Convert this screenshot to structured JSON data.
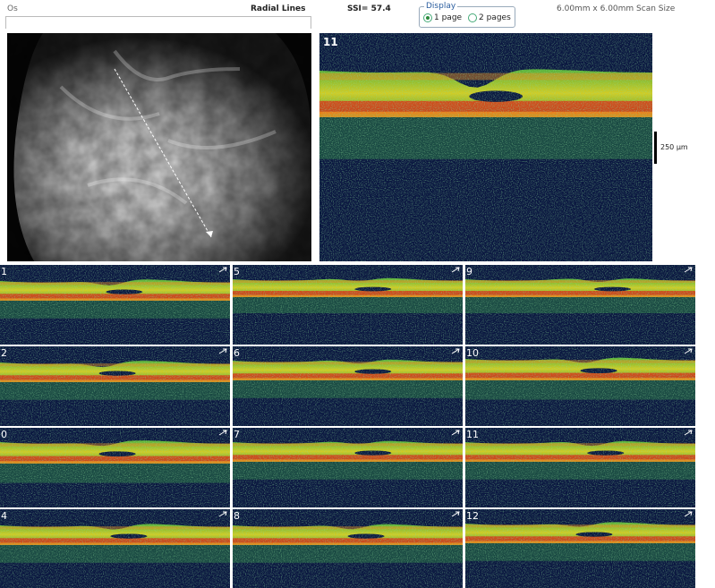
{
  "header": {
    "eye": "Os",
    "protocol": "Radial Lines",
    "ssi": "SSI= 57.4",
    "scan_size": "6.00mm x 6.00mm Scan Size"
  },
  "display": {
    "legend": "Display",
    "options": [
      {
        "label": "1 page",
        "selected": true
      },
      {
        "label": "2 pages",
        "selected": false
      }
    ]
  },
  "main_scan": {
    "label": "11",
    "scale_label": "250 µm"
  },
  "thumbnails": [
    {
      "label": "1"
    },
    {
      "label": "5"
    },
    {
      "label": "9"
    },
    {
      "label": "2"
    },
    {
      "label": "6"
    },
    {
      "label": "10"
    },
    {
      "label": "0"
    },
    {
      "label": "7"
    },
    {
      "label": "11"
    },
    {
      "label": "4"
    },
    {
      "label": "8"
    },
    {
      "label": "12"
    }
  ],
  "colors": {
    "background": "#0a1640",
    "noise_blue": "#2a4aa0",
    "noise_green": "#3aa84a",
    "retina_green": "#5fc23a",
    "retina_yellow": "#e8e020",
    "rpe_red": "#d83a1a",
    "rpe_orange": "#f08a1a"
  },
  "icons": {
    "thumbnail_marker": "arrow-icon",
    "display_option": "radio-icon"
  }
}
